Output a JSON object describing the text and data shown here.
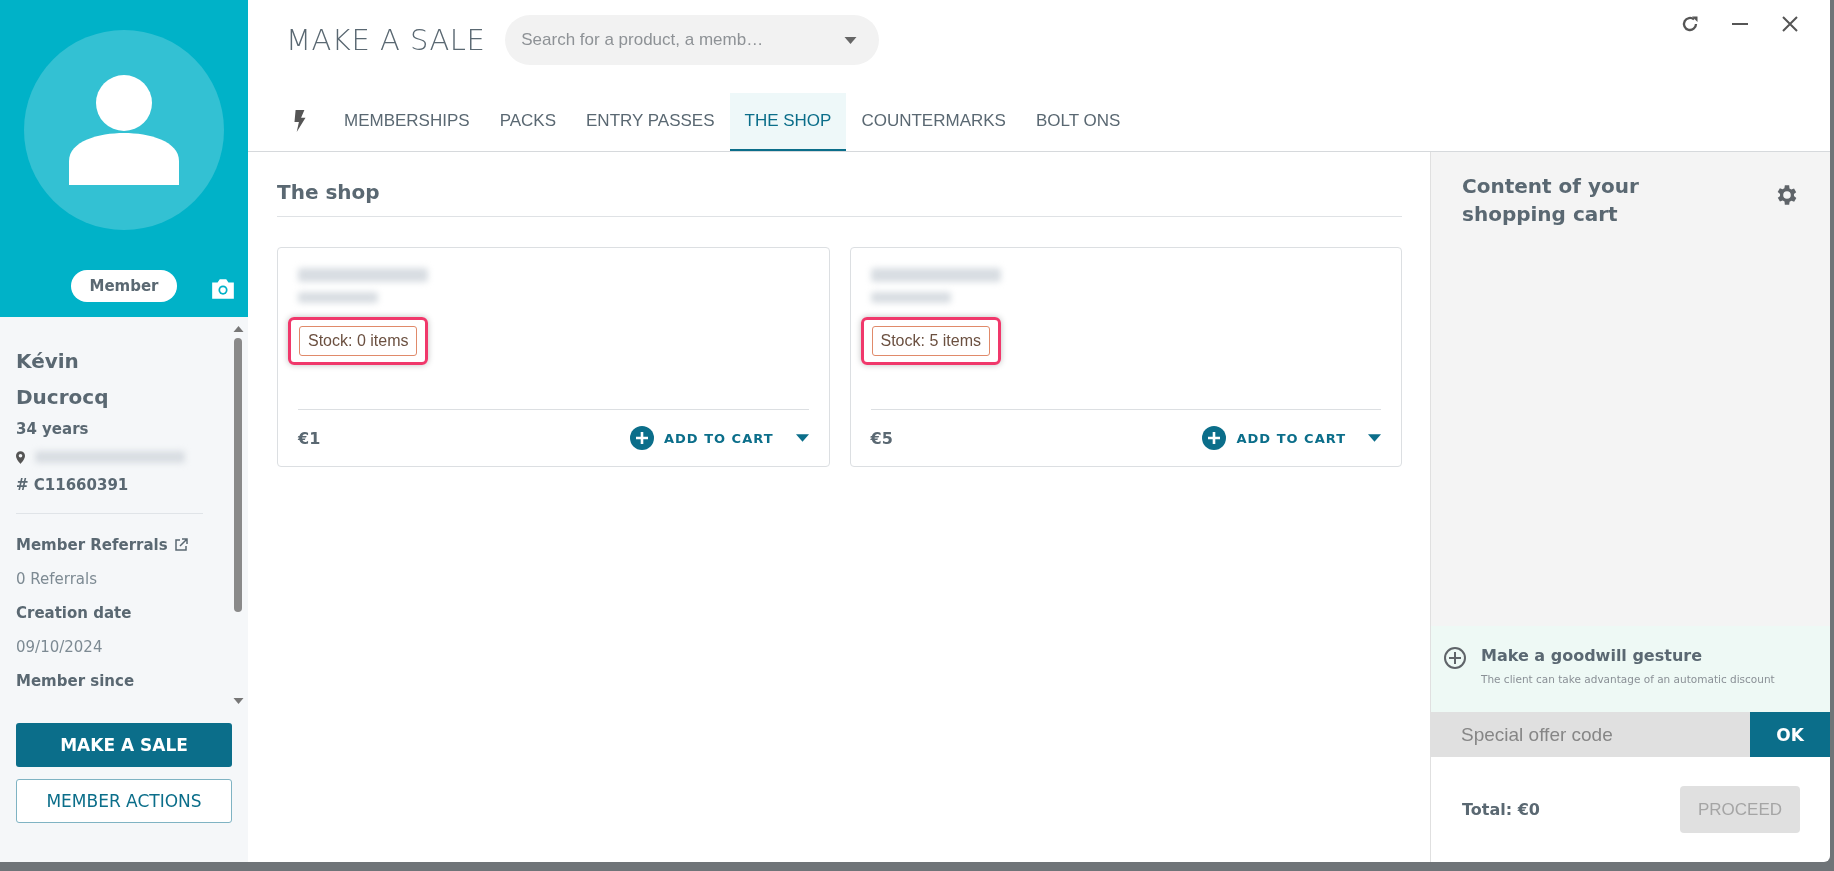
{
  "profile": {
    "badge": "Member",
    "first_name": "Kévin",
    "last_name": "Ducrocq",
    "age": "34 years",
    "member_id": "# C11660391",
    "fields": [
      {
        "label": "Member Referrals",
        "value": "0 Referrals",
        "link": true
      },
      {
        "label": "Creation date",
        "value": "09/10/2024",
        "link": false
      },
      {
        "label": "Member since",
        "link": false
      }
    ]
  },
  "profile_actions": [
    {
      "label": "MAKE A SALE",
      "kind": "primary"
    },
    {
      "label": "MEMBER ACTIONS",
      "kind": "secondary"
    }
  ],
  "header": {
    "title": "MAKE A SALE",
    "search": {
      "placeholder": "Search for a product, a memb…"
    }
  },
  "tabs": [
    {
      "label": "MEMBERSHIPS",
      "selected": false
    },
    {
      "label": "PACKS",
      "selected": false
    },
    {
      "label": "ENTRY PASSES",
      "selected": false
    },
    {
      "label": "THE SHOP",
      "selected": true
    },
    {
      "label": "COUNTERMARKS",
      "selected": false
    },
    {
      "label": "BOLT ONS",
      "selected": false
    }
  ],
  "section": {
    "title": "The shop",
    "products": [
      {
        "stock": "Stock: 0 items",
        "highlighted": true,
        "price": "€1",
        "action": "ADD TO CART"
      },
      {
        "stock": "Stock: 5 items",
        "highlighted": true,
        "price": "€5",
        "action": "ADD TO CART"
      }
    ]
  },
  "cart": {
    "title": "Content of your shopping cart",
    "goodwill": {
      "title": "Make a goodwill gesture",
      "description": "The client can take advantage of an automatic discount"
    },
    "promo": {
      "placeholder": "Special offer code",
      "button": "OK"
    },
    "total": "Total: €0",
    "proceed": {
      "label": "PROCEED",
      "disabled": true
    }
  }
}
